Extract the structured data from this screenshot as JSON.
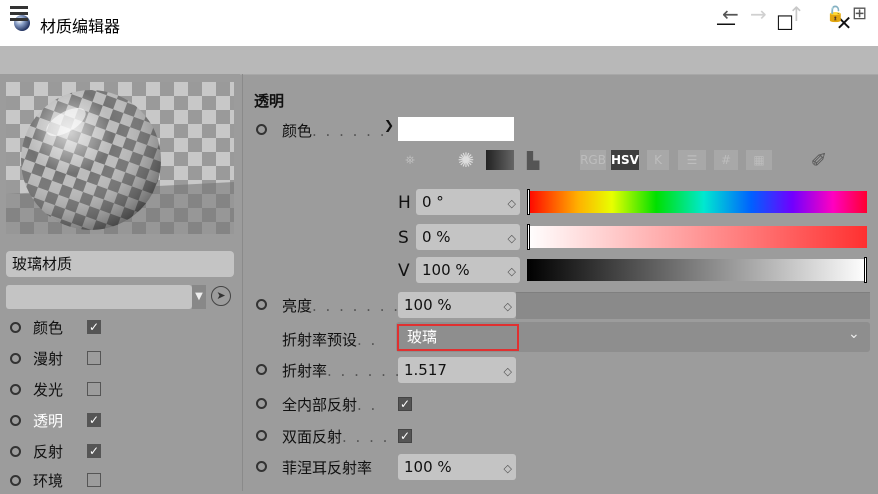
{
  "window": {
    "title": "材质编辑器",
    "controls": {
      "minimize": "—",
      "maximize": "☐",
      "close": "✕"
    }
  },
  "toolbar": {
    "back_icon": "←",
    "forward_icon": "→",
    "up_icon": "↑",
    "lock_icon": "🔓",
    "new_icon": "⊞"
  },
  "material": {
    "name": "玻璃材质",
    "channels": [
      {
        "label": "颜色",
        "checked": true
      },
      {
        "label": "漫射",
        "checked": false
      },
      {
        "label": "发光",
        "checked": false
      },
      {
        "label": "透明",
        "checked": true,
        "active": true
      },
      {
        "label": "反射",
        "checked": true
      },
      {
        "label": "环境",
        "checked": false
      }
    ]
  },
  "panel": {
    "section_title": "透明",
    "color": {
      "label": "颜色",
      "dots": ". . . . . .",
      "swatch": "#ffffff"
    },
    "palette_icons": [
      "RGB",
      "HSV",
      "K"
    ],
    "hsv": {
      "h": {
        "letter": "H",
        "value": "0 °"
      },
      "s": {
        "letter": "S",
        "value": "0 %"
      },
      "v": {
        "letter": "V",
        "value": "100 %"
      }
    },
    "brightness": {
      "label": "亮度",
      "dots": ". . . . . . .",
      "value": "100 %"
    },
    "ior_preset": {
      "label": "折射率预设",
      "dots": ". .",
      "value": "玻璃"
    },
    "ior": {
      "label": "折射率",
      "dots": ". . . . . .",
      "value": "1.517"
    },
    "total_internal": {
      "label": "全内部反射",
      "dots": ". .",
      "checked": true
    },
    "double_sided": {
      "label": "双面反射",
      "dots": ". . . .",
      "checked": true
    },
    "fresnel": {
      "label": "菲涅耳反射率",
      "value": "100 %"
    }
  }
}
